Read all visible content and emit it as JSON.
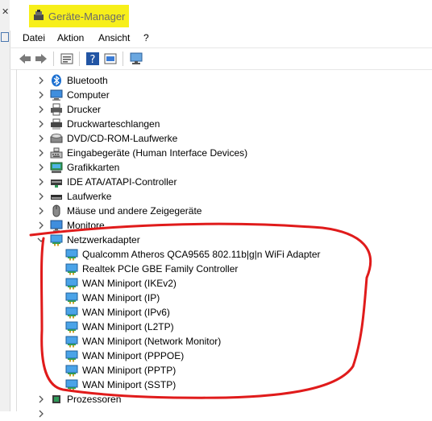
{
  "window": {
    "title": "Geräte-Manager"
  },
  "menu": [
    "Datei",
    "Aktion",
    "Ansicht",
    "?"
  ],
  "toolbar": {
    "icons": [
      "back-arrow-icon",
      "forward-arrow-icon",
      "properties-icon",
      "help-icon",
      "update-driver-icon",
      "monitor-scan-icon"
    ]
  },
  "tree": {
    "categories": [
      {
        "label": "Bluetooth",
        "icon": "bluetooth-icon"
      },
      {
        "label": "Computer",
        "icon": "computer-icon"
      },
      {
        "label": "Drucker",
        "icon": "printer-icon"
      },
      {
        "label": "Druckwarteschlangen",
        "icon": "print-queue-icon"
      },
      {
        "label": "DVD/CD-ROM-Laufwerke",
        "icon": "dvd-drive-icon"
      },
      {
        "label": "Eingabegeräte (Human Interface Devices)",
        "icon": "hid-icon"
      },
      {
        "label": "Grafikkarten",
        "icon": "graphics-card-icon"
      },
      {
        "label": "IDE ATA/ATAPI-Controller",
        "icon": "ide-controller-icon"
      },
      {
        "label": "Laufwerke",
        "icon": "disk-drive-icon"
      },
      {
        "label": "Mäuse und andere Zeigegeräte",
        "icon": "mouse-icon"
      },
      {
        "label": "Monitore",
        "icon": "monitor-icon"
      },
      {
        "label": "Netzwerkadapter",
        "icon": "network-adapter-icon",
        "expanded": true
      }
    ],
    "network_adapters": [
      "Qualcomm Atheros QCA9565 802.11b|g|n WiFi Adapter",
      "Realtek PCIe GBE Family Controller",
      "WAN Miniport (IKEv2)",
      "WAN Miniport (IP)",
      "WAN Miniport (IPv6)",
      "WAN Miniport (L2TP)",
      "WAN Miniport (Network Monitor)",
      "WAN Miniport (PPPOE)",
      "WAN Miniport (PPTP)",
      "WAN Miniport (SSTP)"
    ],
    "after": [
      {
        "label": "Prozessoren",
        "icon": "processor-icon"
      }
    ]
  },
  "colors": {
    "highlight": "#f7ef1a",
    "annotation": "#e01b1b",
    "title_text": "#6b6b6b"
  }
}
